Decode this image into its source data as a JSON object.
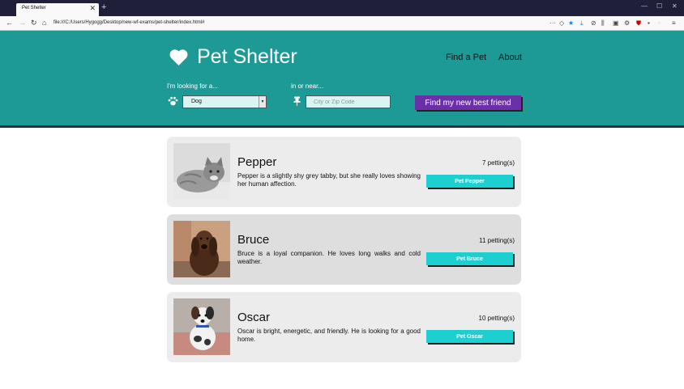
{
  "browser": {
    "tab_title": "Pet Shelter",
    "url": "file:///C:/Users/Hygogg/Desktop/new-wf-exams/pet-shelter/index.html#"
  },
  "header": {
    "title": "Pet Shelter",
    "nav": [
      "Find a Pet",
      "About"
    ],
    "looking_label": "I'm looking for a...",
    "near_label": "in or near...",
    "animal_value": "Dog",
    "location_placeholder": "City or Zip Code",
    "search_button": "Find my new best friend"
  },
  "pets": [
    {
      "name": "Pepper",
      "description": "Pepper is a slightly shy grey tabby, but she really loves showing her human affection.",
      "count": "7 petting(s)",
      "button": "Pet Pepper"
    },
    {
      "name": "Bruce",
      "description": "Bruce is a loyal companion. He loves long walks and cold weather.",
      "count": "11 petting(s)",
      "button": "Pet Bruce"
    },
    {
      "name": "Oscar",
      "description": "Oscar is bright, energetic, and friendly. He is looking for a good home.",
      "count": "10 petting(s)",
      "button": "Pet Oscar"
    }
  ],
  "colors": {
    "header_bg": "#1d9a96",
    "search_button": "#6b2fa8",
    "pet_button": "#1ecfd1"
  }
}
